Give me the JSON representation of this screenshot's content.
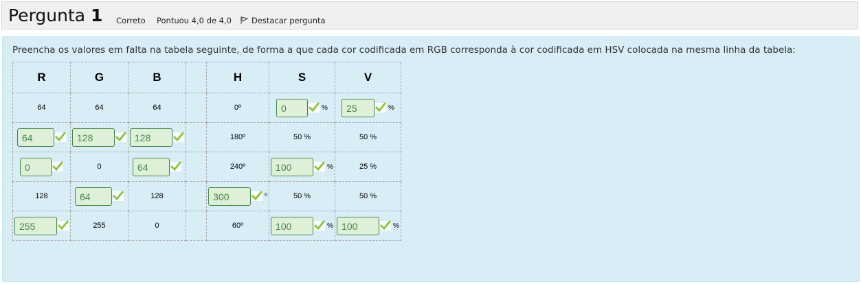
{
  "header": {
    "title_prefix": "Pergunta",
    "title_number": "1",
    "status": "Correto",
    "grade": "Pontuou 4,0 de 4,0",
    "flag_label": "Destacar pergunta",
    "flag_icon": "flag-icon"
  },
  "question": {
    "text": "Preencha os valores em falta na tabela seguinte, de forma a que cada cor codificada em RGB corresponda à cor codificada em HSV colocada na mesma linha da tabela:"
  },
  "colors": {
    "input_bg": "#dff0d8",
    "input_border": "#468847",
    "check": "#8cc63f",
    "content_bg": "#d9edf7"
  },
  "table": {
    "headers": [
      "R",
      "G",
      "B",
      "",
      "H",
      "S",
      "V"
    ],
    "rows": [
      [
        {
          "t": "64"
        },
        {
          "t": "64"
        },
        {
          "t": "64"
        },
        {
          "t": ""
        },
        {
          "t": "0º"
        },
        {
          "v": "0",
          "s": "%"
        },
        {
          "v": "25",
          "s": "%"
        }
      ],
      [
        {
          "v": "64"
        },
        {
          "v": "128"
        },
        {
          "v": "128"
        },
        {
          "t": ""
        },
        {
          "t": "180º"
        },
        {
          "t": "50 %"
        },
        {
          "t": "50 %"
        }
      ],
      [
        {
          "v": "0"
        },
        {
          "t": "0"
        },
        {
          "v": "64"
        },
        {
          "t": ""
        },
        {
          "t": "240º"
        },
        {
          "v": "100",
          "s": "%"
        },
        {
          "t": "25 %"
        }
      ],
      [
        {
          "t": "128"
        },
        {
          "v": "64"
        },
        {
          "t": "128"
        },
        {
          "t": ""
        },
        {
          "v": "300",
          "s": "º"
        },
        {
          "t": "50 %"
        },
        {
          "t": "50 %"
        }
      ],
      [
        {
          "v": "255"
        },
        {
          "t": "255"
        },
        {
          "t": "0"
        },
        {
          "t": ""
        },
        {
          "t": "60º"
        },
        {
          "v": "100",
          "s": "%"
        },
        {
          "v": "100",
          "s": "%"
        }
      ]
    ]
  }
}
